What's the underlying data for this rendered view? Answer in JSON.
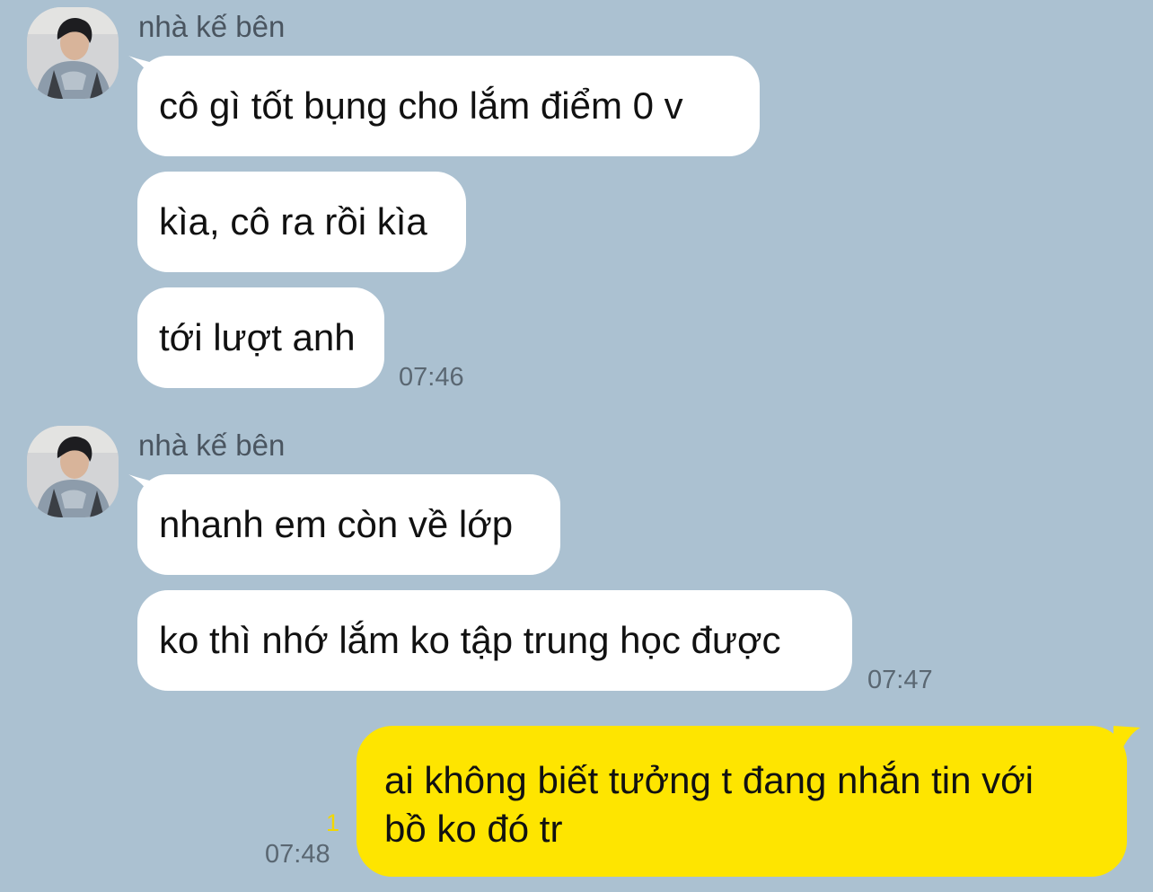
{
  "theme": {
    "background": "#abc1d1",
    "incoming_bubble": "#ffffff",
    "outgoing_bubble": "#fee500",
    "unread_color": "#f2d700"
  },
  "groups": [
    {
      "sender": "nhà kế bên",
      "avatar_icon": "profile-photo-icon",
      "messages": [
        "cô gì tốt bụng cho lắm điểm 0 v",
        "kìa, cô ra rồi kìa",
        "tới lượt anh"
      ],
      "time": "07:46"
    },
    {
      "sender": "nhà kế bên",
      "avatar_icon": "profile-photo-icon",
      "messages": [
        "nhanh em còn về lớp",
        "ko thì nhớ lắm ko tập trung học được"
      ],
      "time": "07:47"
    }
  ],
  "outgoing": {
    "lines": [
      "ai không biết tưởng t đang nhắn tin với",
      "bồ ko đó tr"
    ],
    "unread_count": "1",
    "time": "07:48"
  }
}
